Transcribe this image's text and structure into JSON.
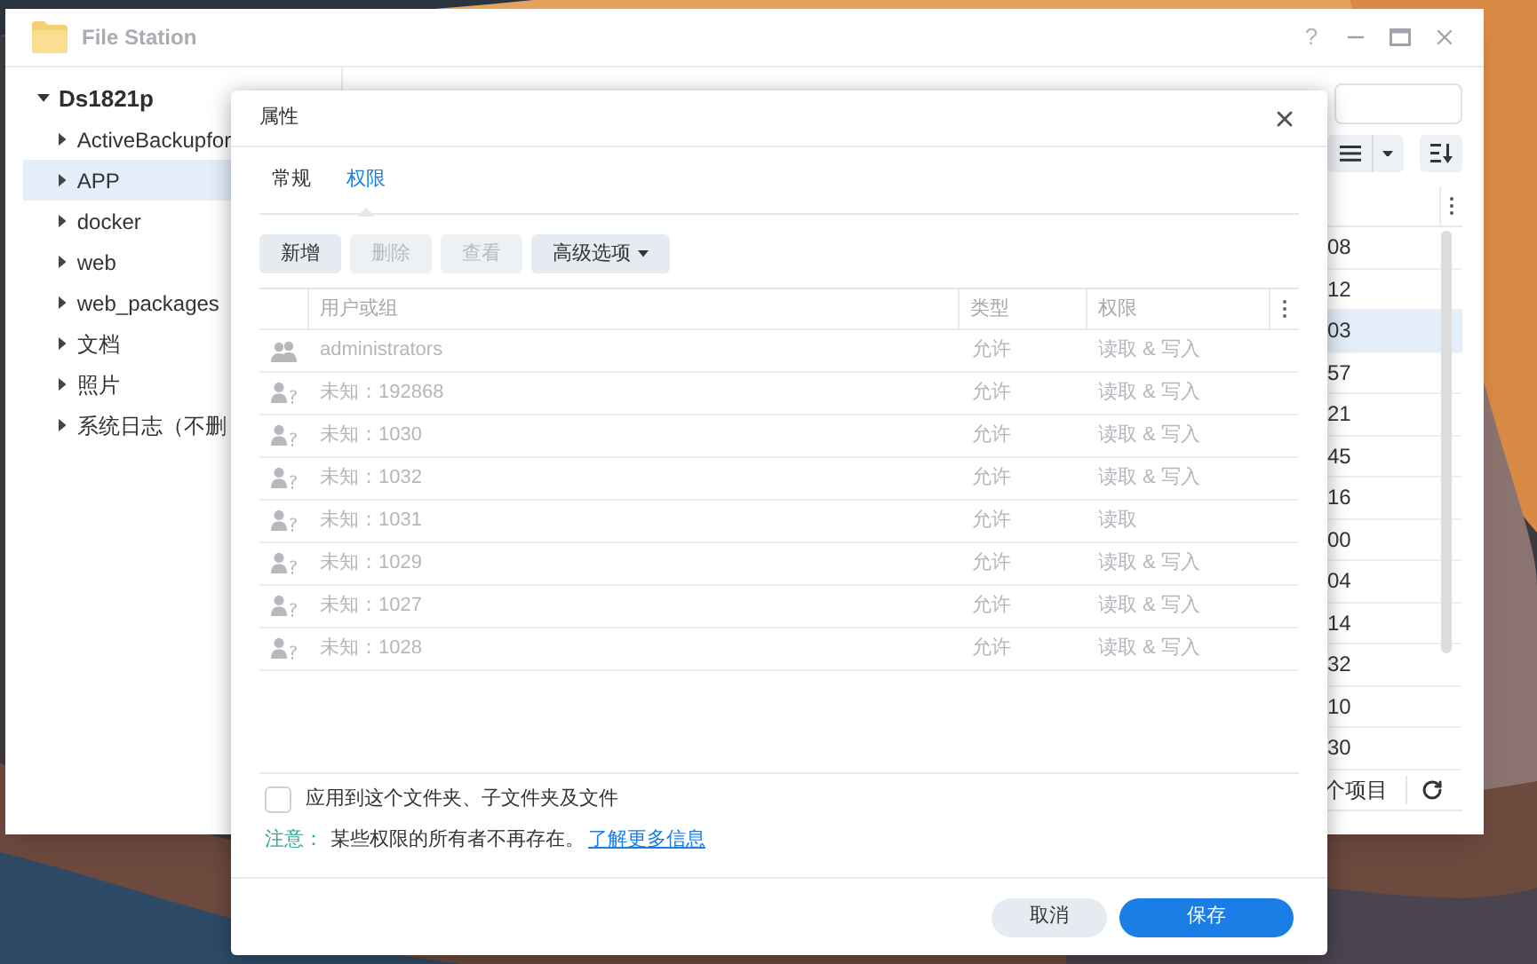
{
  "window": {
    "title": "File Station",
    "help_glyph": "?"
  },
  "sidebar": {
    "root": {
      "label": "Ds1821p",
      "expanded": true,
      "children": [
        {
          "label": "ActiveBackupfor",
          "selected": false
        },
        {
          "label": "APP",
          "selected": true
        },
        {
          "label": "docker",
          "selected": false
        },
        {
          "label": "web",
          "selected": false
        },
        {
          "label": "web_packages",
          "selected": false
        },
        {
          "label": "文档",
          "selected": false
        },
        {
          "label": "照片",
          "selected": false
        },
        {
          "label": "系统日志（不删",
          "selected": false
        }
      ]
    }
  },
  "file_list": {
    "rows": [
      {
        "column_1": "08",
        "selected": false
      },
      {
        "column_1": "12",
        "selected": false
      },
      {
        "column_1": "03",
        "selected": true
      },
      {
        "column_1": "57",
        "selected": false
      },
      {
        "column_1": "21",
        "selected": false
      },
      {
        "column_1": "45",
        "selected": false
      },
      {
        "column_1": "16",
        "selected": false
      },
      {
        "column_1": "00",
        "selected": false
      },
      {
        "column_1": "04",
        "selected": false
      },
      {
        "column_1": "14",
        "selected": false
      },
      {
        "column_1": "32",
        "selected": false
      },
      {
        "column_1": "10",
        "selected": false
      },
      {
        "column_1": "30",
        "selected": false
      }
    ],
    "status": "个项目"
  },
  "dialog": {
    "title": "属性",
    "tabs": [
      {
        "label": "常规",
        "selected": false
      },
      {
        "label": "权限",
        "selected": true
      }
    ],
    "buttons": [
      {
        "label": "新增",
        "disabled": false,
        "dropdown": false
      },
      {
        "label": "删除",
        "disabled": true,
        "dropdown": false
      },
      {
        "label": "查看",
        "disabled": true,
        "dropdown": false
      },
      {
        "label": "高级选项",
        "disabled": false,
        "dropdown": true
      }
    ],
    "table": {
      "columns": [
        "用户或组",
        "类型",
        "权限"
      ],
      "rows": [
        {
          "kind": "group",
          "user": "administrators",
          "type": "允许",
          "permission": "读取 & 写入"
        },
        {
          "kind": "unknown",
          "user": "未知：192868",
          "type": "允许",
          "permission": "读取 & 写入"
        },
        {
          "kind": "unknown",
          "user": "未知：1030",
          "type": "允许",
          "permission": "读取 & 写入"
        },
        {
          "kind": "unknown",
          "user": "未知：1032",
          "type": "允许",
          "permission": "读取 & 写入"
        },
        {
          "kind": "unknown",
          "user": "未知：1031",
          "type": "允许",
          "permission": "读取"
        },
        {
          "kind": "unknown",
          "user": "未知：1029",
          "type": "允许",
          "permission": "读取 & 写入"
        },
        {
          "kind": "unknown",
          "user": "未知：1027",
          "type": "允许",
          "permission": "读取 & 写入"
        },
        {
          "kind": "unknown",
          "user": "未知：1028",
          "type": "允许",
          "permission": "读取 & 写入"
        }
      ]
    },
    "apply_checkbox": {
      "label": "应用到这个文件夹、子文件夹及文件",
      "checked": false
    },
    "note": {
      "label": "注意：",
      "text": "某些权限的所有者不再存在。",
      "link": "了解更多信息"
    },
    "footer_buttons": [
      {
        "label": "取消",
        "primary": false
      },
      {
        "label": "保存",
        "primary": true
      }
    ]
  }
}
